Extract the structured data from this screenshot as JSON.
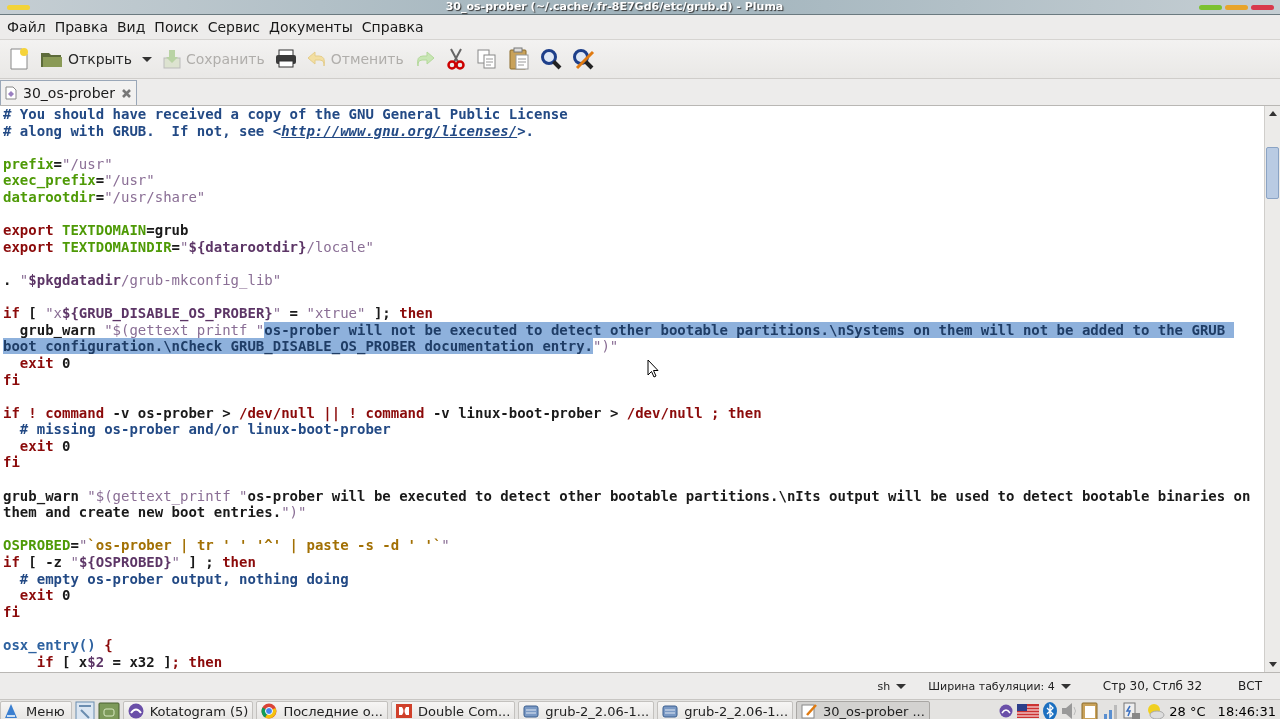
{
  "window": {
    "title": "30_os-prober (~/.cache/.fr-8E7Gd6/etc/grub.d) - Pluma"
  },
  "menu": [
    "Файл",
    "Правка",
    "Вид",
    "Поиск",
    "Сервис",
    "Документы",
    "Справка"
  ],
  "toolbar": {
    "open": {
      "label": "Открыть"
    },
    "save": {
      "label": "Сохранить",
      "disabled": true
    },
    "undo": {
      "label": "Отменить",
      "disabled": true
    },
    "redo": {
      "disabled": true
    }
  },
  "tabs": [
    {
      "label": "30_os-prober",
      "selected": true
    }
  ],
  "editor": {
    "lines": [
      {
        "kind": "code",
        "tokens": [
          {
            "kind": "comment",
            "text": "# You should have received a copy of the GNU General Public License"
          }
        ]
      },
      {
        "kind": "code",
        "tokens": [
          {
            "kind": "comment",
            "text": "# along with GRUB.  If not, see <"
          },
          {
            "kind": "link",
            "text": "http://www.gnu.org/licenses/"
          },
          {
            "kind": "comment",
            "text": ">."
          }
        ]
      },
      {
        "kind": "blank"
      },
      {
        "kind": "code",
        "tokens": [
          {
            "kind": "variable",
            "text": "prefix"
          },
          {
            "kind": "plain",
            "text": "="
          },
          {
            "kind": "string",
            "text": "\"/usr\""
          }
        ]
      },
      {
        "kind": "code",
        "tokens": [
          {
            "kind": "variable",
            "text": "exec_prefix"
          },
          {
            "kind": "plain",
            "text": "="
          },
          {
            "kind": "string",
            "text": "\"/usr\""
          }
        ]
      },
      {
        "kind": "code",
        "tokens": [
          {
            "kind": "variable",
            "text": "datarootdir"
          },
          {
            "kind": "plain",
            "text": "="
          },
          {
            "kind": "string",
            "text": "\"/usr/share\""
          }
        ]
      },
      {
        "kind": "blank"
      },
      {
        "kind": "code",
        "tokens": [
          {
            "kind": "keyword",
            "text": "export"
          },
          {
            "kind": "variable",
            "text": " TEXTDOMAIN"
          },
          {
            "kind": "plain",
            "text": "=grub"
          }
        ]
      },
      {
        "kind": "code",
        "tokens": [
          {
            "kind": "keyword",
            "text": "export"
          },
          {
            "kind": "variable",
            "text": " TEXTDOMAINDIR"
          },
          {
            "kind": "plain",
            "text": "="
          },
          {
            "kind": "string",
            "text": "\""
          },
          {
            "kind": "param",
            "text": "${datarootdir}"
          },
          {
            "kind": "string",
            "text": "/locale\""
          }
        ]
      },
      {
        "kind": "blank"
      },
      {
        "kind": "code",
        "tokens": [
          {
            "kind": "plain",
            "text": ". "
          },
          {
            "kind": "string",
            "text": "\""
          },
          {
            "kind": "param",
            "text": "$pkgdatadir"
          },
          {
            "kind": "string",
            "text": "/grub-mkconfig_lib\""
          }
        ]
      },
      {
        "kind": "blank"
      },
      {
        "kind": "code",
        "tokens": [
          {
            "kind": "keyword",
            "text": "if"
          },
          {
            "kind": "plain",
            "text": " [ "
          },
          {
            "kind": "string",
            "text": "\"x"
          },
          {
            "kind": "param",
            "text": "${GRUB_DISABLE_OS_PROBER}"
          },
          {
            "kind": "string",
            "text": "\""
          },
          {
            "kind": "plain",
            "text": " = "
          },
          {
            "kind": "string",
            "text": "\"xtrue\""
          },
          {
            "kind": "plain",
            "text": " ]; "
          },
          {
            "kind": "keyword",
            "text": "then"
          }
        ]
      },
      {
        "kind": "code",
        "tokens": [
          {
            "kind": "plain",
            "text": "  grub_warn "
          },
          {
            "kind": "string",
            "text": "\"$(gettext_printf \""
          },
          {
            "kind": "selected",
            "text": "os-prober will not be executed to detect other bootable partitions.\\nSystems on them will not be added to the GRUB boot configuration.\\nCheck GRUB_DISABLE_OS_PROBER documentation entry."
          },
          {
            "kind": "string",
            "text": "\")\""
          }
        ]
      },
      {
        "kind": "code",
        "tokens": [
          {
            "kind": "keyword",
            "text": "  exit"
          },
          {
            "kind": "plain",
            "text": " 0"
          }
        ]
      },
      {
        "kind": "code",
        "tokens": [
          {
            "kind": "keyword",
            "text": "fi"
          }
        ]
      },
      {
        "kind": "blank"
      },
      {
        "kind": "code",
        "tokens": [
          {
            "kind": "keyword",
            "text": "if ! command"
          },
          {
            "kind": "plain",
            "text": " -v os-prober > "
          },
          {
            "kind": "keyword",
            "text": "/dev/null || ! command"
          },
          {
            "kind": "plain",
            "text": " -v linux-boot-prober > "
          },
          {
            "kind": "keyword",
            "text": "/dev/null ; then"
          }
        ]
      },
      {
        "kind": "code",
        "tokens": [
          {
            "kind": "comment",
            "text": "  # missing os-prober and/or linux-boot-prober"
          }
        ]
      },
      {
        "kind": "code",
        "tokens": [
          {
            "kind": "keyword",
            "text": "  exit"
          },
          {
            "kind": "plain",
            "text": " 0"
          }
        ]
      },
      {
        "kind": "code",
        "tokens": [
          {
            "kind": "keyword",
            "text": "fi"
          }
        ]
      },
      {
        "kind": "blank"
      },
      {
        "kind": "code",
        "tokens": [
          {
            "kind": "plain",
            "text": "grub_warn "
          },
          {
            "kind": "string",
            "text": "\"$(gettext_printf \""
          },
          {
            "kind": "plain",
            "text": "os-prober will be executed to detect other bootable partitions.\\nIts output will be used to detect bootable binaries on them and create new boot entries."
          },
          {
            "kind": "string",
            "text": "\")\""
          }
        ]
      },
      {
        "kind": "blank"
      },
      {
        "kind": "code",
        "tokens": [
          {
            "kind": "variable",
            "text": "OSPROBED"
          },
          {
            "kind": "plain",
            "text": "="
          },
          {
            "kind": "string",
            "text": "\""
          },
          {
            "kind": "backtick",
            "text": "`os-prober | tr ' ' '^' | paste -s -d ' '`"
          },
          {
            "kind": "string",
            "text": "\""
          }
        ]
      },
      {
        "kind": "code",
        "tokens": [
          {
            "kind": "keyword",
            "text": "if"
          },
          {
            "kind": "plain",
            "text": " [ -z "
          },
          {
            "kind": "string",
            "text": "\""
          },
          {
            "kind": "param",
            "text": "${OSPROBED}"
          },
          {
            "kind": "string",
            "text": "\""
          },
          {
            "kind": "plain",
            "text": " ] ; "
          },
          {
            "kind": "keyword",
            "text": "then"
          }
        ]
      },
      {
        "kind": "code",
        "tokens": [
          {
            "kind": "comment",
            "text": "  # empty os-prober output, nothing doing"
          }
        ]
      },
      {
        "kind": "code",
        "tokens": [
          {
            "kind": "keyword",
            "text": "  exit"
          },
          {
            "kind": "plain",
            "text": " 0"
          }
        ]
      },
      {
        "kind": "code",
        "tokens": [
          {
            "kind": "keyword",
            "text": "fi"
          }
        ]
      },
      {
        "kind": "blank"
      },
      {
        "kind": "code",
        "tokens": [
          {
            "kind": "function",
            "text": "osx_entry()"
          },
          {
            "kind": "keyword",
            "text": " {"
          }
        ]
      },
      {
        "kind": "code",
        "tokens": [
          {
            "kind": "keyword",
            "text": "    if"
          },
          {
            "kind": "plain",
            "text": " [ x"
          },
          {
            "kind": "param",
            "text": "$2"
          },
          {
            "kind": "plain",
            "text": " = x32 ]"
          },
          {
            "kind": "keyword",
            "text": "; then"
          }
        ]
      }
    ]
  },
  "status_bar": {
    "language": "sh",
    "tab_width": "Ширина табуляции:  4",
    "position": "Стр 30, Стлб 32",
    "mode": "ВСТ"
  },
  "taskbar": {
    "menu": "Меню",
    "windows": [
      {
        "label": "Kotatogram (5)",
        "selected": false
      },
      {
        "label": "Последние о...",
        "selected": false
      },
      {
        "label": "Double Com...",
        "selected": false
      },
      {
        "label": "grub-2_2.06-1...",
        "selected": false
      },
      {
        "label": "grub-2_2.06-1...",
        "selected": false
      },
      {
        "label": "30_os-prober ...",
        "selected": true
      }
    ],
    "weather": "28 °C",
    "clock": "18:46:31"
  }
}
